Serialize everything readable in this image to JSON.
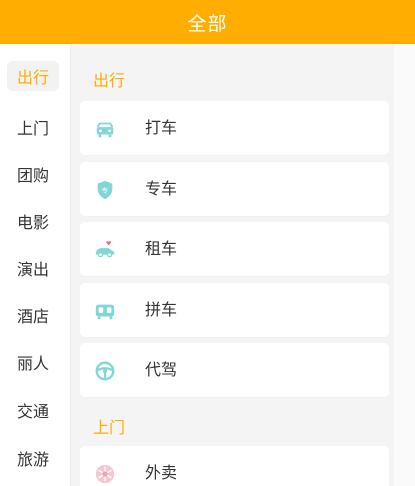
{
  "header": {
    "title": "全部"
  },
  "sidebar": {
    "items": [
      {
        "label": "出行",
        "active": true
      },
      {
        "label": "上门",
        "active": false
      },
      {
        "label": "团购",
        "active": false
      },
      {
        "label": "电影",
        "active": false
      },
      {
        "label": "演出",
        "active": false
      },
      {
        "label": "酒店",
        "active": false
      },
      {
        "label": "丽人",
        "active": false
      },
      {
        "label": "交通",
        "active": false
      },
      {
        "label": "旅游",
        "active": false
      }
    ]
  },
  "main": {
    "sections": [
      {
        "title": "出行",
        "items": [
          {
            "label": "打车",
            "icon": "taxi-icon"
          },
          {
            "label": "专车",
            "icon": "shield-car-icon"
          },
          {
            "label": "租车",
            "icon": "rental-car-icon"
          },
          {
            "label": "拼车",
            "icon": "carpool-icon"
          },
          {
            "label": "代驾",
            "icon": "steering-wheel-icon"
          }
        ]
      },
      {
        "title": "上门",
        "items": [
          {
            "label": "外卖",
            "icon": "takeout-icon"
          }
        ]
      }
    ]
  },
  "colors": {
    "accent": "#ffad01",
    "icon": "#82d6d6",
    "background": "#f4f4f4",
    "card": "#ffffff",
    "text": "#333333"
  }
}
